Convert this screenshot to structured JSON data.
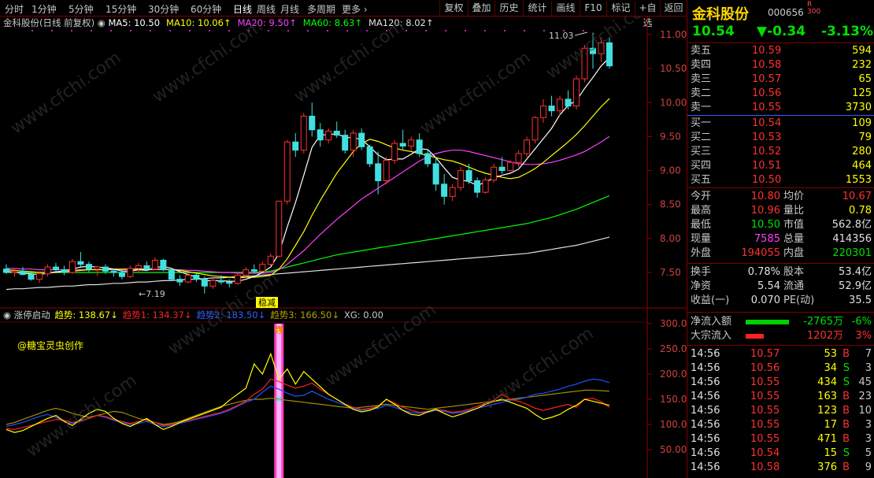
{
  "toolbar": {
    "tabs": [
      "分时",
      "1分钟",
      "5分钟",
      "15分钟",
      "30分钟",
      "60分钟",
      "日线",
      "周线",
      "月线",
      "多周期",
      "更多"
    ],
    "active_tab": "日线",
    "buttons": [
      "复权",
      "叠加",
      "历史",
      "统计",
      "画线",
      "F10",
      "标记",
      "+自选",
      "返回"
    ]
  },
  "main_chart": {
    "name": "金科股份(日线 前复权)",
    "ma_labels": [
      {
        "text": "MA5: 10.50",
        "color": "#ffffff"
      },
      {
        "text": "MA10: 10.06",
        "color": "#ffff00"
      },
      {
        "text": "MA20: 9.50",
        "color": "#ff40ff"
      },
      {
        "text": "MA60: 8.63",
        "color": "#00ff00"
      },
      {
        "text": "MA120: 8.02",
        "color": "#e0e0e0"
      }
    ],
    "y_ticks": [
      "11.00",
      "10.50",
      "10.00",
      "9.50",
      "9.00",
      "8.50",
      "8.00",
      "7.50"
    ],
    "high_label": "11.03",
    "low_label": "7.19",
    "badge": "稳减"
  },
  "indicator": {
    "name": "涨停启动",
    "values": [
      {
        "text": "趋势: 138.67",
        "color": "#ffff00"
      },
      {
        "text": "趋势1: 134.37",
        "color": "#ff2020"
      },
      {
        "text": "趋势2: 183.50",
        "color": "#3060ff"
      },
      {
        "text": "趋势3: 166.50",
        "color": "#b0a000"
      },
      {
        "text": "XG: 0.00",
        "color": "#c8c8c8"
      }
    ],
    "author": "@糖宝灵虫创作",
    "y_ticks": [
      "300.0",
      "250.0",
      "200.0",
      "150.0",
      "100.0",
      "50.00"
    ]
  },
  "quote": {
    "name": "金科股份",
    "code": "000656",
    "tag": "R",
    "tag_sub": "300",
    "price": "10.54",
    "change": "▼-0.34",
    "change_pct": "-3.13%",
    "asks": [
      {
        "label": "卖五",
        "price": "10.59",
        "vol": "594"
      },
      {
        "label": "卖四",
        "price": "10.58",
        "vol": "232"
      },
      {
        "label": "卖三",
        "price": "10.57",
        "vol": "65"
      },
      {
        "label": "卖二",
        "price": "10.56",
        "vol": "125"
      },
      {
        "label": "卖一",
        "price": "10.55",
        "vol": "3730"
      }
    ],
    "bids": [
      {
        "label": "买一",
        "price": "10.54",
        "vol": "109"
      },
      {
        "label": "买二",
        "price": "10.53",
        "vol": "79"
      },
      {
        "label": "买三",
        "price": "10.52",
        "vol": "280"
      },
      {
        "label": "买四",
        "price": "10.51",
        "vol": "464"
      },
      {
        "label": "买五",
        "price": "10.50",
        "vol": "1553"
      }
    ],
    "stats1": [
      {
        "l1": "今开",
        "v1": "10.80",
        "c1": "r",
        "l2": "均价",
        "v2": "10.67",
        "c2": "r"
      },
      {
        "l1": "最高",
        "v1": "10.96",
        "c1": "r",
        "l2": "量比",
        "v2": "0.78",
        "c2": "y"
      },
      {
        "l1": "最低",
        "v1": "10.50",
        "c1": "g",
        "l2": "市值",
        "v2": "562.8亿",
        "c2": "w"
      },
      {
        "l1": "现量",
        "v1": "7585",
        "c1": "m",
        "l2": "总量",
        "v2": "414356",
        "c2": "w"
      },
      {
        "l1": "外盘",
        "v1": "194055",
        "c1": "r",
        "l2": "内盘",
        "v2": "220301",
        "c2": "g"
      }
    ],
    "stats2": [
      {
        "l1": "换手",
        "v1": "0.78%",
        "c1": "w",
        "l2": "股本",
        "v2": "53.4亿",
        "c2": "w"
      },
      {
        "l1": "净资",
        "v1": "5.54",
        "c1": "w",
        "l2": "流通",
        "v2": "52.9亿",
        "c2": "w"
      },
      {
        "l1": "收益(一)",
        "v1": "0.070",
        "c1": "w",
        "l2": "PE(动)",
        "v2": "35.5",
        "c2": "w"
      }
    ],
    "flow": [
      {
        "label": "净流入额",
        "value": "-2765万",
        "pct": "-6%",
        "bar_color": "#00d000",
        "bar_fraction": 0.95,
        "value_color": "g",
        "pct_color": "g"
      },
      {
        "label": "大宗流入",
        "value": "1202万",
        "pct": "3%",
        "bar_color": "#ff2020",
        "bar_fraction": 0.4,
        "value_color": "r",
        "pct_color": "r"
      }
    ],
    "ticks": [
      {
        "time": "14:56",
        "price": "10.57",
        "vol": "53",
        "side": "B",
        "n": "7"
      },
      {
        "time": "14:56",
        "price": "10.56",
        "vol": "34",
        "side": "S",
        "n": "3"
      },
      {
        "time": "14:56",
        "price": "10.55",
        "vol": "434",
        "side": "S",
        "n": "45"
      },
      {
        "time": "14:56",
        "price": "10.55",
        "vol": "163",
        "side": "B",
        "n": "23"
      },
      {
        "time": "14:56",
        "price": "10.55",
        "vol": "123",
        "side": "B",
        "n": "10"
      },
      {
        "time": "14:56",
        "price": "10.55",
        "vol": "17",
        "side": "B",
        "n": "3"
      },
      {
        "time": "14:56",
        "price": "10.55",
        "vol": "471",
        "side": "B",
        "n": "3"
      },
      {
        "time": "14:56",
        "price": "10.54",
        "vol": "15",
        "side": "S",
        "n": "5"
      },
      {
        "time": "14:56",
        "price": "10.58",
        "vol": "376",
        "side": "B",
        "n": "9"
      }
    ]
  },
  "chart_data": {
    "type": "candlestick",
    "y_range": [
      7.2,
      11.1
    ],
    "candles": [
      [
        7.55,
        7.62,
        7.48,
        7.5
      ],
      [
        7.5,
        7.56,
        7.44,
        7.52
      ],
      [
        7.52,
        7.58,
        7.46,
        7.47
      ],
      [
        7.47,
        7.5,
        7.38,
        7.4
      ],
      [
        7.4,
        7.5,
        7.35,
        7.48
      ],
      [
        7.48,
        7.62,
        7.44,
        7.58
      ],
      [
        7.58,
        7.64,
        7.5,
        7.54
      ],
      [
        7.54,
        7.6,
        7.46,
        7.5
      ],
      [
        7.5,
        7.7,
        7.48,
        7.66
      ],
      [
        7.66,
        7.8,
        7.58,
        7.62
      ],
      [
        7.62,
        7.66,
        7.5,
        7.55
      ],
      [
        7.55,
        7.6,
        7.45,
        7.58
      ],
      [
        7.58,
        7.62,
        7.48,
        7.52
      ],
      [
        7.52,
        7.56,
        7.44,
        7.5
      ],
      [
        7.5,
        7.54,
        7.4,
        7.44
      ],
      [
        7.44,
        7.6,
        7.42,
        7.56
      ],
      [
        7.56,
        7.64,
        7.5,
        7.6
      ],
      [
        7.6,
        7.66,
        7.52,
        7.55
      ],
      [
        7.55,
        7.72,
        7.54,
        7.68
      ],
      [
        7.68,
        7.7,
        7.52,
        7.54
      ],
      [
        7.54,
        7.56,
        7.38,
        7.4
      ],
      [
        7.4,
        7.46,
        7.3,
        7.36
      ],
      [
        7.36,
        7.5,
        7.34,
        7.46
      ],
      [
        7.46,
        7.48,
        7.36,
        7.4
      ],
      [
        7.4,
        7.44,
        7.19,
        7.3
      ],
      [
        7.3,
        7.42,
        7.26,
        7.38
      ],
      [
        7.38,
        7.46,
        7.32,
        7.36
      ],
      [
        7.36,
        7.4,
        7.28,
        7.34
      ],
      [
        7.34,
        7.5,
        7.32,
        7.46
      ],
      [
        7.46,
        7.58,
        7.42,
        7.54
      ],
      [
        7.54,
        7.62,
        7.48,
        7.52
      ],
      [
        7.52,
        7.66,
        7.5,
        7.62
      ],
      [
        7.62,
        7.78,
        7.6,
        7.74
      ],
      [
        7.74,
        8.55,
        7.72,
        8.55
      ],
      [
        8.55,
        9.45,
        8.5,
        9.42
      ],
      [
        9.42,
        9.55,
        9.2,
        9.3
      ],
      [
        9.3,
        9.85,
        9.25,
        9.8
      ],
      [
        9.8,
        10.0,
        9.5,
        9.6
      ],
      [
        9.6,
        9.7,
        9.35,
        9.45
      ],
      [
        9.45,
        9.62,
        9.4,
        9.58
      ],
      [
        9.58,
        9.72,
        9.48,
        9.52
      ],
      [
        9.52,
        9.6,
        9.25,
        9.3
      ],
      [
        9.3,
        9.6,
        9.2,
        9.55
      ],
      [
        9.55,
        9.62,
        9.3,
        9.35
      ],
      [
        9.35,
        9.38,
        9.05,
        9.1
      ],
      [
        9.1,
        9.28,
        8.65,
        8.85
      ],
      [
        8.85,
        9.2,
        8.8,
        9.15
      ],
      [
        9.15,
        9.45,
        9.1,
        9.4
      ],
      [
        9.4,
        9.6,
        9.3,
        9.36
      ],
      [
        9.36,
        9.5,
        9.3,
        9.45
      ],
      [
        9.45,
        9.55,
        9.2,
        9.25
      ],
      [
        9.25,
        9.3,
        9.05,
        9.1
      ],
      [
        9.1,
        9.2,
        8.7,
        8.8
      ],
      [
        8.8,
        8.95,
        8.5,
        8.62
      ],
      [
        8.62,
        8.8,
        8.55,
        8.75
      ],
      [
        8.75,
        9.05,
        8.7,
        9.0
      ],
      [
        9.0,
        9.1,
        8.8,
        8.85
      ],
      [
        8.85,
        8.9,
        8.6,
        8.68
      ],
      [
        8.68,
        8.9,
        8.66,
        8.86
      ],
      [
        8.86,
        9.1,
        8.82,
        9.05
      ],
      [
        9.05,
        9.2,
        8.95,
        9.0
      ],
      [
        9.0,
        9.15,
        8.98,
        9.12
      ],
      [
        9.12,
        9.3,
        9.05,
        9.25
      ],
      [
        9.25,
        9.5,
        9.2,
        9.45
      ],
      [
        9.45,
        9.8,
        9.4,
        9.78
      ],
      [
        9.78,
        10.05,
        9.7,
        9.95
      ],
      [
        9.95,
        10.1,
        9.8,
        9.88
      ],
      [
        9.88,
        10.1,
        9.8,
        10.05
      ],
      [
        10.05,
        10.18,
        9.9,
        9.95
      ],
      [
        9.95,
        10.4,
        9.9,
        10.35
      ],
      [
        10.35,
        10.85,
        10.3,
        10.8
      ],
      [
        10.8,
        11.03,
        10.5,
        10.72
      ],
      [
        10.72,
        10.96,
        10.6,
        10.88
      ],
      [
        10.88,
        10.96,
        10.5,
        10.54
      ]
    ],
    "ma5": [
      7.52,
      7.5,
      7.49,
      7.48,
      7.47,
      7.49,
      7.51,
      7.52,
      7.55,
      7.58,
      7.59,
      7.58,
      7.57,
      7.55,
      7.52,
      7.52,
      7.54,
      7.53,
      7.57,
      7.59,
      7.56,
      7.51,
      7.47,
      7.43,
      7.38,
      7.38,
      7.38,
      7.37,
      7.37,
      7.4,
      7.44,
      7.5,
      7.58,
      7.78,
      8.17,
      8.53,
      8.93,
      9.34,
      9.52,
      9.53,
      9.54,
      9.49,
      9.48,
      9.46,
      9.35,
      9.23,
      9.16,
      9.17,
      9.17,
      9.24,
      9.32,
      9.31,
      9.19,
      9.04,
      8.9,
      8.86,
      8.84,
      8.78,
      8.83,
      8.89,
      8.93,
      8.96,
      9.02,
      9.17,
      9.32,
      9.47,
      9.62,
      9.82,
      9.96,
      10.03,
      10.21,
      10.37,
      10.54,
      10.66
    ],
    "ma10": [
      7.54,
      7.53,
      7.52,
      7.51,
      7.5,
      7.5,
      7.5,
      7.51,
      7.52,
      7.53,
      7.54,
      7.54,
      7.54,
      7.55,
      7.55,
      7.55,
      7.55,
      7.55,
      7.55,
      7.55,
      7.54,
      7.53,
      7.51,
      7.49,
      7.47,
      7.45,
      7.44,
      7.43,
      7.42,
      7.43,
      7.43,
      7.44,
      7.46,
      7.55,
      7.7,
      7.9,
      8.1,
      8.34,
      8.56,
      8.76,
      8.96,
      9.12,
      9.28,
      9.4,
      9.46,
      9.43,
      9.38,
      9.33,
      9.3,
      9.28,
      9.25,
      9.22,
      9.19,
      9.16,
      9.14,
      9.1,
      9.05,
      9.0,
      8.96,
      8.93,
      8.9,
      8.88,
      8.9,
      8.96,
      9.03,
      9.12,
      9.22,
      9.32,
      9.42,
      9.53,
      9.66,
      9.8,
      9.94,
      10.06
    ],
    "ma20": [
      7.56,
      7.56,
      7.55,
      7.55,
      7.54,
      7.54,
      7.54,
      7.54,
      7.54,
      7.54,
      7.54,
      7.54,
      7.54,
      7.54,
      7.54,
      7.54,
      7.54,
      7.54,
      7.54,
      7.54,
      7.54,
      7.54,
      7.53,
      7.53,
      7.52,
      7.51,
      7.5,
      7.5,
      7.49,
      7.49,
      7.49,
      7.49,
      7.5,
      7.54,
      7.62,
      7.72,
      7.82,
      7.94,
      8.06,
      8.17,
      8.28,
      8.38,
      8.48,
      8.58,
      8.66,
      8.74,
      8.82,
      8.9,
      8.98,
      9.06,
      9.14,
      9.2,
      9.25,
      9.28,
      9.3,
      9.3,
      9.28,
      9.25,
      9.22,
      9.19,
      9.16,
      9.13,
      9.1,
      9.09,
      9.09,
      9.1,
      9.12,
      9.15,
      9.19,
      9.23,
      9.28,
      9.35,
      9.42,
      9.5
    ],
    "ma60": [
      7.5,
      7.5,
      7.5,
      7.5,
      7.5,
      7.5,
      7.5,
      7.5,
      7.5,
      7.5,
      7.5,
      7.5,
      7.5,
      7.5,
      7.5,
      7.5,
      7.5,
      7.5,
      7.5,
      7.5,
      7.5,
      7.5,
      7.5,
      7.5,
      7.5,
      7.5,
      7.5,
      7.5,
      7.5,
      7.5,
      7.5,
      7.51,
      7.52,
      7.55,
      7.58,
      7.61,
      7.64,
      7.67,
      7.7,
      7.73,
      7.76,
      7.78,
      7.8,
      7.82,
      7.84,
      7.86,
      7.88,
      7.9,
      7.92,
      7.94,
      7.96,
      7.98,
      8.0,
      8.02,
      8.04,
      8.06,
      8.08,
      8.1,
      8.12,
      8.14,
      8.16,
      8.18,
      8.2,
      8.22,
      8.25,
      8.28,
      8.31,
      8.35,
      8.39,
      8.43,
      8.48,
      8.53,
      8.58,
      8.63
    ],
    "ma120": [
      7.25,
      7.26,
      7.26,
      7.27,
      7.28,
      7.28,
      7.29,
      7.3,
      7.3,
      7.31,
      7.32,
      7.32,
      7.33,
      7.34,
      7.34,
      7.35,
      7.36,
      7.36,
      7.37,
      7.38,
      7.38,
      7.39,
      7.4,
      7.4,
      7.41,
      7.42,
      7.42,
      7.43,
      7.44,
      7.44,
      7.45,
      7.46,
      7.47,
      7.48,
      7.49,
      7.5,
      7.51,
      7.52,
      7.53,
      7.54,
      7.55,
      7.56,
      7.57,
      7.58,
      7.59,
      7.6,
      7.61,
      7.62,
      7.63,
      7.64,
      7.65,
      7.66,
      7.67,
      7.68,
      7.69,
      7.7,
      7.71,
      7.72,
      7.73,
      7.74,
      7.75,
      7.76,
      7.77,
      7.78,
      7.8,
      7.82,
      7.84,
      7.86,
      7.88,
      7.9,
      7.93,
      7.96,
      7.99,
      8.02
    ],
    "indicator_range": [
      0,
      330
    ],
    "trend": [
      90,
      84,
      88,
      96,
      104,
      112,
      118,
      106,
      98,
      110,
      122,
      130,
      126,
      112,
      102,
      96,
      104,
      112,
      100,
      90,
      96,
      104,
      110,
      116,
      122,
      128,
      134,
      148,
      160,
      172,
      220,
      200,
      240,
      190,
      210,
      180,
      205,
      190,
      175,
      160,
      150,
      140,
      130,
      125,
      128,
      135,
      150,
      140,
      128,
      120,
      118,
      125,
      130,
      122,
      115,
      120,
      126,
      132,
      140,
      146,
      150,
      144,
      138,
      132,
      120,
      110,
      114,
      120,
      130,
      138,
      150,
      146,
      142,
      138
    ],
    "trend1": [
      92,
      90,
      94,
      98,
      102,
      106,
      110,
      108,
      104,
      108,
      112,
      118,
      116,
      110,
      106,
      102,
      106,
      110,
      104,
      98,
      100,
      104,
      108,
      112,
      116,
      120,
      124,
      130,
      138,
      146,
      160,
      170,
      190,
      185,
      178,
      172,
      176,
      182,
      170,
      160,
      150,
      140,
      134,
      130,
      132,
      136,
      150,
      142,
      134,
      128,
      124,
      126,
      130,
      128,
      124,
      126,
      130,
      136,
      142,
      148,
      160,
      150,
      146,
      140,
      132,
      128,
      132,
      136,
      140,
      134,
      150,
      152,
      145,
      134
    ],
    "trend2": [
      96,
      100,
      104,
      110,
      116,
      120,
      114,
      108,
      102,
      106,
      112,
      118,
      114,
      108,
      104,
      100,
      102,
      106,
      100,
      96,
      98,
      102,
      106,
      110,
      114,
      118,
      122,
      128,
      136,
      144,
      150,
      164,
      176,
      170,
      162,
      156,
      158,
      166,
      158,
      150,
      144,
      138,
      132,
      128,
      130,
      132,
      138,
      134,
      128,
      124,
      122,
      124,
      128,
      126,
      122,
      124,
      128,
      132,
      136,
      140,
      144,
      148,
      150,
      154,
      160,
      162,
      166,
      170,
      176,
      180,
      186,
      190,
      188,
      183
    ],
    "trend3": [
      100,
      104,
      110,
      116,
      122,
      128,
      132,
      128,
      122,
      118,
      114,
      118,
      122,
      126,
      124,
      118,
      112,
      108,
      104,
      100,
      102,
      106,
      112,
      118,
      124,
      130,
      136,
      140,
      144,
      148,
      150,
      150,
      152,
      150,
      148,
      146,
      144,
      142,
      140,
      138,
      136,
      134,
      132,
      134,
      136,
      138,
      140,
      138,
      136,
      134,
      132,
      130,
      132,
      134,
      136,
      138,
      140,
      142,
      144,
      146,
      148,
      150,
      152,
      154,
      156,
      158,
      160,
      162,
      164,
      166,
      168,
      168,
      167,
      166
    ]
  }
}
